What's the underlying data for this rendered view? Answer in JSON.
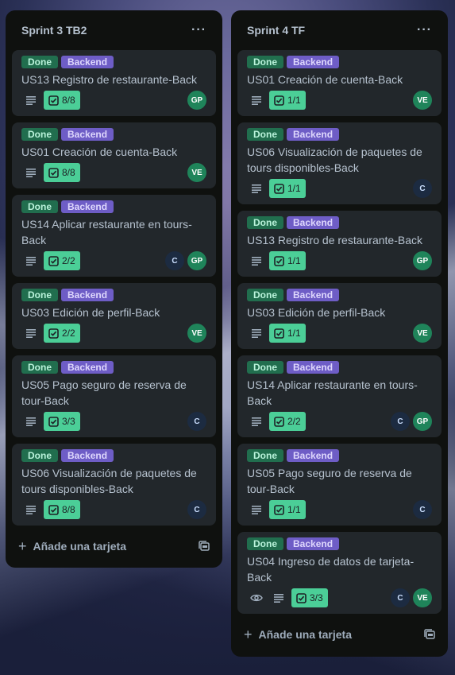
{
  "lists": [
    {
      "title": "Sprint 3 TB2",
      "menu": "···",
      "add_card": "Añade una tarjeta",
      "cards": [
        {
          "labels": [
            "Done",
            "Backend"
          ],
          "title": "US13 Registro de restaurante-Back",
          "checklist": "8/8",
          "members": [
            "GP"
          ]
        },
        {
          "labels": [
            "Done",
            "Backend"
          ],
          "title": "US01 Creación de cuenta-Back",
          "checklist": "8/8",
          "members": [
            "VE"
          ]
        },
        {
          "labels": [
            "Done",
            "Backend"
          ],
          "title": "US14 Aplicar restaurante en tours-Back",
          "checklist": "2/2",
          "members": [
            "C",
            "GP"
          ]
        },
        {
          "labels": [
            "Done",
            "Backend"
          ],
          "title": "US03 Edición de perfil-Back",
          "checklist": "2/2",
          "members": [
            "VE"
          ]
        },
        {
          "labels": [
            "Done",
            "Backend"
          ],
          "title": "US05 Pago seguro de reserva de tour-Back",
          "checklist": "3/3",
          "members": [
            "C"
          ]
        },
        {
          "labels": [
            "Done",
            "Backend"
          ],
          "title": "US06 Visualización de paquetes de tours disponibles-Back",
          "checklist": "8/8",
          "members": [
            "C"
          ]
        }
      ]
    },
    {
      "title": "Sprint 4 TF",
      "menu": "···",
      "add_card": "Añade una tarjeta",
      "cards": [
        {
          "labels": [
            "Done",
            "Backend"
          ],
          "title": "US01 Creación de cuenta-Back",
          "checklist": "1/1",
          "members": [
            "VE"
          ]
        },
        {
          "labels": [
            "Done",
            "Backend"
          ],
          "title": "US06 Visualización de paquetes de tours disponibles-Back",
          "checklist": "1/1",
          "members": [
            "C"
          ]
        },
        {
          "labels": [
            "Done",
            "Backend"
          ],
          "title": "US13 Registro de restaurante-Back",
          "checklist": "1/1",
          "members": [
            "GP"
          ]
        },
        {
          "labels": [
            "Done",
            "Backend"
          ],
          "title": "US03 Edición de perfil-Back",
          "checklist": "1/1",
          "members": [
            "VE"
          ]
        },
        {
          "labels": [
            "Done",
            "Backend"
          ],
          "title": "US14 Aplicar restaurante en tours-Back",
          "checklist": "2/2",
          "members": [
            "C",
            "GP"
          ]
        },
        {
          "labels": [
            "Done",
            "Backend"
          ],
          "title": "US05 Pago seguro de reserva de tour-Back",
          "checklist": "1/1",
          "members": [
            "C"
          ]
        },
        {
          "labels": [
            "Done",
            "Backend"
          ],
          "title": "US04 Ingreso de datos de tarjeta-Back",
          "checklist": "3/3",
          "members": [
            "C",
            "VE"
          ],
          "watching": true
        }
      ]
    }
  ],
  "colors": {
    "label_done": "#216e4e",
    "label_backend": "#6e5dc6",
    "checklist_complete": "#4bce97",
    "avatar_green": "#1f845a",
    "avatar_navy": "#1c2b41"
  },
  "icons": {
    "description": "description-icon",
    "checklist": "checklist-icon",
    "watch": "eye-icon",
    "menu": "more-icon",
    "add": "plus-icon",
    "template": "template-icon"
  }
}
